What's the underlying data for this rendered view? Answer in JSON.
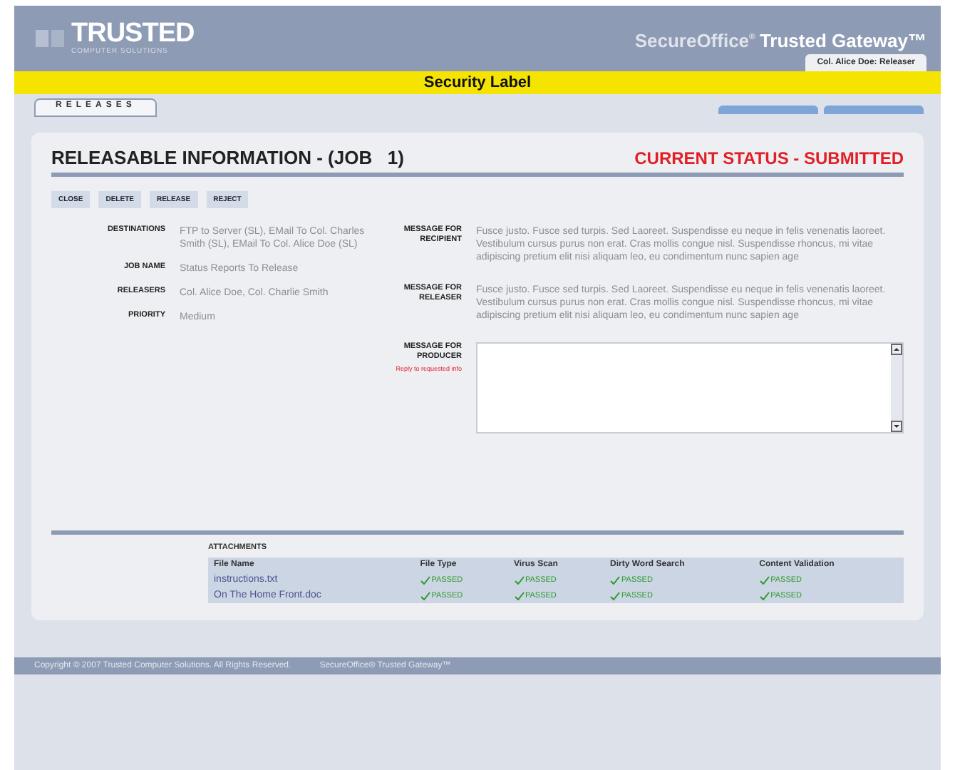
{
  "header": {
    "logo": "TRUSTED",
    "logo_sub": "COMPUTER SOLUTIONS",
    "product": "SecureOffice",
    "product_mark": "®",
    "gateway": "Trusted Gateway™",
    "user": "Col. Alice Doe: Releaser"
  },
  "security_label": "Security Label",
  "nav": {
    "tab": "RELEASES",
    "pager_tabs": [
      {
        "kind": "tab"
      },
      {
        "kind": "tab"
      }
    ]
  },
  "panel": {
    "title": "RELEASABLE INFORMATION - (JOB   1)",
    "status": "CURRENT STATUS - SUBMITTED",
    "actions": [
      "CLOSE",
      "DELETE",
      "RELEASE",
      "REJECT"
    ],
    "fields": [
      {
        "label": "DESTINATIONS",
        "value": "FTP to Server (SL), EMail To Col. Charles Smith (SL), EMail To Col. Alice Doe (SL)"
      },
      {
        "label": "JOB NAME",
        "value": "Status Reports To Release"
      },
      {
        "label": "RELEASERS",
        "value": "Col. Alice Doe, Col. Charlie Smith"
      },
      {
        "label": "PRIORITY",
        "value": "Medium"
      }
    ],
    "messages": [
      {
        "kind": "text",
        "label": "MESSAGE FOR RECIPIENT",
        "value": "Fusce justo. Fusce sed turpis. Sed Laoreet. Suspendisse eu neque in felis venenatis laoreet. Vestibulum cursus purus non erat. Cras mollis congue nisl. Suspendisse rhoncus, mi vitae adipiscing pretium elit nisi aliquam leo, eu condimentum nunc sapien age"
      },
      {
        "kind": "text",
        "label": "MESSAGE FOR RELEASER",
        "value": "Fusce justo. Fusce sed turpis. Sed Laoreet. Suspendisse eu neque in felis venenatis laoreet. Vestibulum cursus purus non erat. Cras mollis congue nisl. Suspendisse rhoncus, mi vitae adipiscing pretium elit nisi aliquam leo, eu condimentum nunc sapien age"
      },
      {
        "kind": "input",
        "label": "MESSAGE FOR PRODUCER",
        "note": "Reply to requested info"
      }
    ],
    "attachments": {
      "title": "ATTACHMENTS",
      "columns": [
        "File Name",
        "File Type",
        "Virus Scan",
        "Dirty Word Search",
        "Content Validation"
      ],
      "rows": [
        {
          "name": "instructions.txt",
          "checks": [
            "PASSED",
            "PASSED",
            "PASSED",
            "PASSED"
          ]
        },
        {
          "name": "On The Home Front.doc",
          "checks": [
            "PASSED",
            "PASSED",
            "PASSED",
            "PASSED"
          ]
        }
      ]
    }
  },
  "footer": {
    "copyright": "Copyright © 2007 Trusted Computer Solutions. All Rights Reserved.",
    "product": "SecureOffice® Trusted Gateway™"
  }
}
